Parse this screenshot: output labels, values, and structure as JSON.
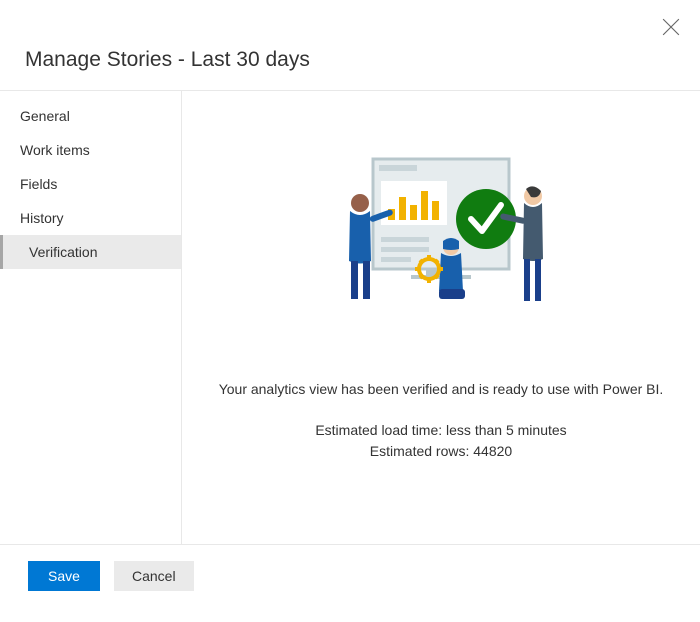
{
  "header": {
    "title": "Manage Stories - Last 30 days"
  },
  "sidebar": {
    "items": [
      {
        "label": "General"
      },
      {
        "label": "Work items"
      },
      {
        "label": "Fields"
      },
      {
        "label": "History"
      },
      {
        "label": "Verification"
      }
    ],
    "selectedIndex": 4
  },
  "verification": {
    "message": "Your analytics view has been verified and is ready to use with Power BI.",
    "loadTime": "Estimated load time: less than 5 minutes",
    "rows": "Estimated rows: 44820"
  },
  "footer": {
    "save": "Save",
    "cancel": "Cancel"
  }
}
